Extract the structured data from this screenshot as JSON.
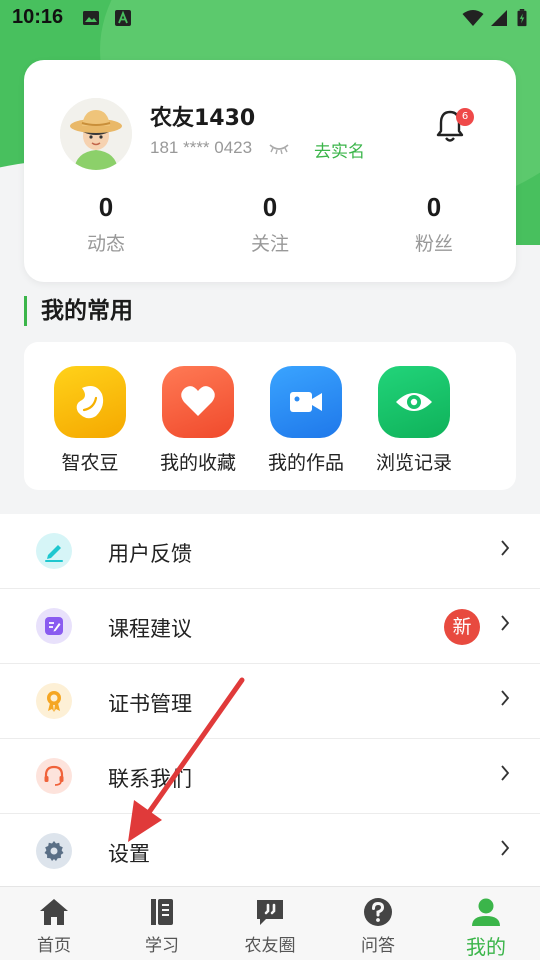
{
  "status_bar": {
    "time": "10:16"
  },
  "profile": {
    "username": "农友1430",
    "phone": "181 **** 0423",
    "verify_link": "去实名",
    "notification_count": "6",
    "stats": [
      {
        "value": "0",
        "label": "动态"
      },
      {
        "value": "0",
        "label": "关注"
      },
      {
        "value": "0",
        "label": "粉丝"
      }
    ]
  },
  "favorites": {
    "title": "我的常用",
    "items": [
      {
        "label": "智农豆",
        "icon": "bean-icon",
        "color": "#f5b800"
      },
      {
        "label": "我的收藏",
        "icon": "heart-icon",
        "color": "#f4603e"
      },
      {
        "label": "我的作品",
        "icon": "video-camera-icon",
        "color": "#2c8cf4"
      },
      {
        "label": "浏览记录",
        "icon": "eye-icon",
        "color": "#17c36a"
      }
    ]
  },
  "menu": [
    {
      "label": "用户反馈",
      "icon": "pencil-icon"
    },
    {
      "label": "课程建议",
      "icon": "edit-note-icon",
      "badge": "新"
    },
    {
      "label": "证书管理",
      "icon": "award-icon"
    },
    {
      "label": "联系我们",
      "icon": "headset-icon"
    },
    {
      "label": "设置",
      "icon": "gear-icon"
    }
  ],
  "bottom_nav": [
    {
      "label": "首页",
      "icon": "home-icon"
    },
    {
      "label": "学习",
      "icon": "book-icon"
    },
    {
      "label": "农友圈",
      "icon": "quote-bubble-icon"
    },
    {
      "label": "问答",
      "icon": "question-icon"
    },
    {
      "label": "我的",
      "icon": "person-icon",
      "active": true
    }
  ],
  "colors": {
    "brand_green": "#3bb54a",
    "header_green": "#48c05e",
    "arrow_red": "#e03a3a"
  }
}
